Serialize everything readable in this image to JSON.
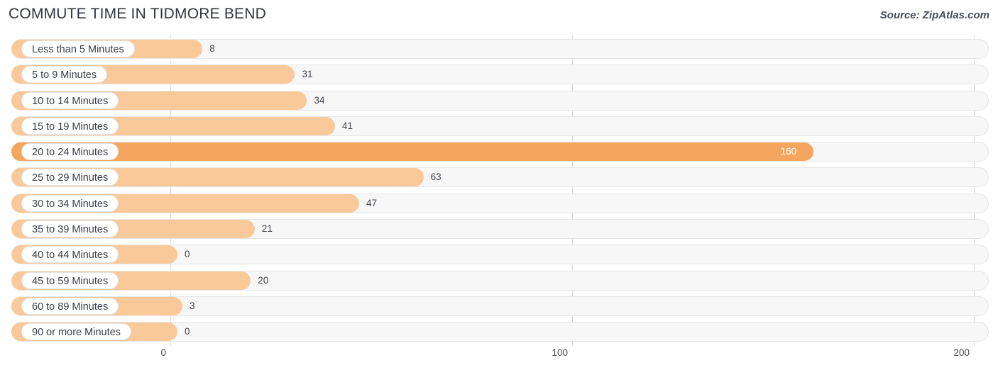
{
  "header": {
    "title": "COMMUTE TIME IN TIDMORE BEND",
    "source": "Source: ZipAtlas.com"
  },
  "colors": {
    "bar": "#FAC999",
    "bar_highlight": "#F5A65E",
    "track": "#F7F7F7",
    "gridline": "#D8D8DC",
    "text": "#44484F"
  },
  "chart_data": {
    "type": "bar",
    "orientation": "horizontal",
    "title": "COMMUTE TIME IN TIDMORE BEND",
    "xlabel": "",
    "ylabel": "",
    "xlim": [
      0,
      200
    ],
    "ticks": [
      "0",
      "100",
      "200"
    ],
    "tick_values": [
      0,
      100,
      200
    ],
    "grid": true,
    "legend": false,
    "categories": [
      "Less than 5 Minutes",
      "5 to 9 Minutes",
      "10 to 14 Minutes",
      "15 to 19 Minutes",
      "20 to 24 Minutes",
      "25 to 29 Minutes",
      "30 to 34 Minutes",
      "35 to 39 Minutes",
      "40 to 44 Minutes",
      "45 to 59 Minutes",
      "60 to 89 Minutes",
      "90 or more Minutes"
    ],
    "values": [
      8,
      31,
      34,
      41,
      160,
      63,
      47,
      21,
      0,
      20,
      3,
      0
    ],
    "value_labels": [
      "8",
      "31",
      "34",
      "41",
      "160",
      "63",
      "47",
      "21",
      "0",
      "20",
      "3",
      "0"
    ],
    "highlight_index": 4
  }
}
